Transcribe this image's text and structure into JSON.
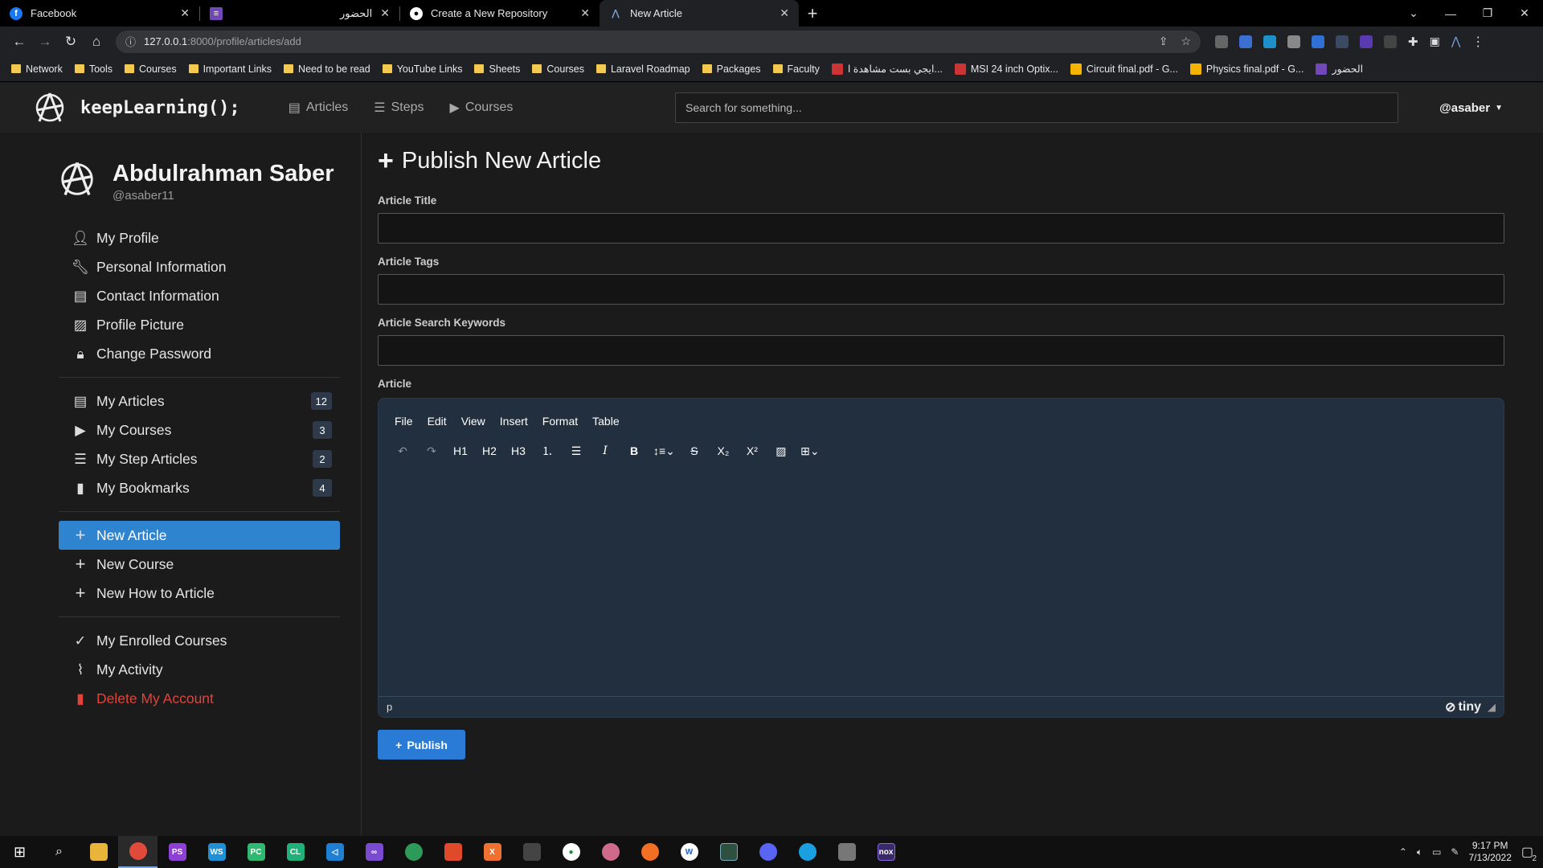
{
  "browser": {
    "tabs": [
      {
        "title": "Facebook",
        "active": false
      },
      {
        "title": "الحضور",
        "active": false
      },
      {
        "title": "Create a New Repository",
        "active": false
      },
      {
        "title": "New Article",
        "active": true
      }
    ],
    "url_host": "127.0.0.1",
    "url_path": ":8000/profile/articles/add",
    "bookmarks": [
      {
        "label": "Network",
        "icon": "folder"
      },
      {
        "label": "Tools",
        "icon": "folder"
      },
      {
        "label": "Courses",
        "icon": "folder"
      },
      {
        "label": "Important Links",
        "icon": "folder"
      },
      {
        "label": "Need to be read",
        "icon": "folder"
      },
      {
        "label": "YouTube Links",
        "icon": "folder"
      },
      {
        "label": "Sheets",
        "icon": "folder"
      },
      {
        "label": "Courses",
        "icon": "folder"
      },
      {
        "label": "Laravel Roadmap",
        "icon": "folder"
      },
      {
        "label": "Packages",
        "icon": "folder"
      },
      {
        "label": "Faculty",
        "icon": "folder"
      },
      {
        "label": "ايجي بست مشاهدة ا...",
        "icon": "site"
      },
      {
        "label": "MSI 24 inch Optix...",
        "icon": "site"
      },
      {
        "label": "Circuit final.pdf - G...",
        "icon": "drive"
      },
      {
        "label": "Physics final.pdf - G...",
        "icon": "drive"
      },
      {
        "label": "الحضور",
        "icon": "forms"
      }
    ]
  },
  "header": {
    "brand": "keepLearning();",
    "nav": [
      {
        "label": "Articles",
        "icon": "newspaper-icon"
      },
      {
        "label": "Steps",
        "icon": "list-check-icon"
      },
      {
        "label": "Courses",
        "icon": "play-icon"
      }
    ],
    "search_placeholder": "Search for something...",
    "user": "@asaber"
  },
  "profile": {
    "name": "Abdulrahman Saber",
    "handle": "@asaber11"
  },
  "sidebar": {
    "group1": [
      {
        "label": "My Profile",
        "icon": "user-icon"
      },
      {
        "label": "Personal Information",
        "icon": "wrench-icon"
      },
      {
        "label": "Contact Information",
        "icon": "address-card-icon"
      },
      {
        "label": "Profile Picture",
        "icon": "image-icon"
      },
      {
        "label": "Change Password",
        "icon": "lock-icon"
      }
    ],
    "group2": [
      {
        "label": "My Articles",
        "icon": "newspaper-icon",
        "count": "12"
      },
      {
        "label": "My Courses",
        "icon": "play-icon",
        "count": "3"
      },
      {
        "label": "My Step Articles",
        "icon": "list-check-icon",
        "count": "2"
      },
      {
        "label": "My Bookmarks",
        "icon": "bookmark-icon",
        "count": "4"
      }
    ],
    "group3": [
      {
        "label": "New Article",
        "icon": "plus-icon",
        "active": true
      },
      {
        "label": "New Course",
        "icon": "plus-icon"
      },
      {
        "label": "New How to Article",
        "icon": "plus-icon"
      }
    ],
    "group4": [
      {
        "label": "My Enrolled Courses",
        "icon": "check-icon"
      },
      {
        "label": "My Activity",
        "icon": "chart-line-icon"
      },
      {
        "label": "Delete My Account",
        "icon": "trash-icon",
        "danger": true
      }
    ]
  },
  "form": {
    "title": "Publish New Article",
    "labels": {
      "title": "Article Title",
      "tags": "Article Tags",
      "keywords": "Article Search Keywords",
      "article": "Article"
    },
    "values": {
      "title": "",
      "tags": "",
      "keywords": ""
    },
    "editor": {
      "menus": [
        "File",
        "Edit",
        "View",
        "Insert",
        "Format",
        "Table"
      ],
      "headings": [
        "H1",
        "H2",
        "H3"
      ],
      "status_path": "p",
      "brand": "tiny"
    },
    "submit_label": "Publish"
  },
  "taskbar": {
    "time": "9:17 PM",
    "date": "7/13/2022",
    "notifications": "2"
  },
  "colors": {
    "accent": "#2f84d0",
    "editor_bg": "#222f3e",
    "danger": "#e0443a"
  }
}
